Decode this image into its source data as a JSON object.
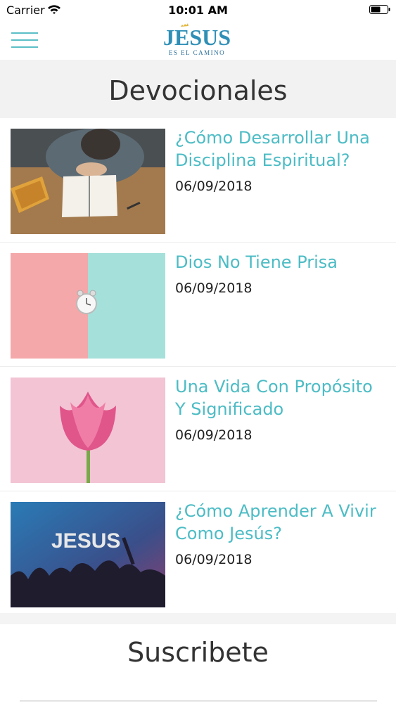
{
  "status_bar": {
    "carrier": "Carrier",
    "time": "10:01 AM"
  },
  "header": {
    "logo_text": "JESUS",
    "logo_subtitle": "ES EL CAMINO",
    "accent": "#4cbcc5",
    "menu_icon": "hamburger-icon"
  },
  "section": {
    "title": "Devocionales"
  },
  "articles": [
    {
      "title": "¿Cómo Desarrollar Una Disciplina Espiritual?",
      "date": "06/09/2018",
      "image": "person-reading-bible"
    },
    {
      "title": "Dios No Tiene Prisa",
      "date": "06/09/2018",
      "image": "alarm-clock-pastel"
    },
    {
      "title": "Una Vida Con Propósito Y Significado",
      "date": "06/09/2018",
      "image": "pink-tulip"
    },
    {
      "title": "¿Cómo Aprender A Vivir Como Jesús?",
      "date": "06/09/2018",
      "image": "jesus-worship-concert",
      "image_text": "JESUS"
    }
  ],
  "subscribe": {
    "title": "Suscribete"
  }
}
